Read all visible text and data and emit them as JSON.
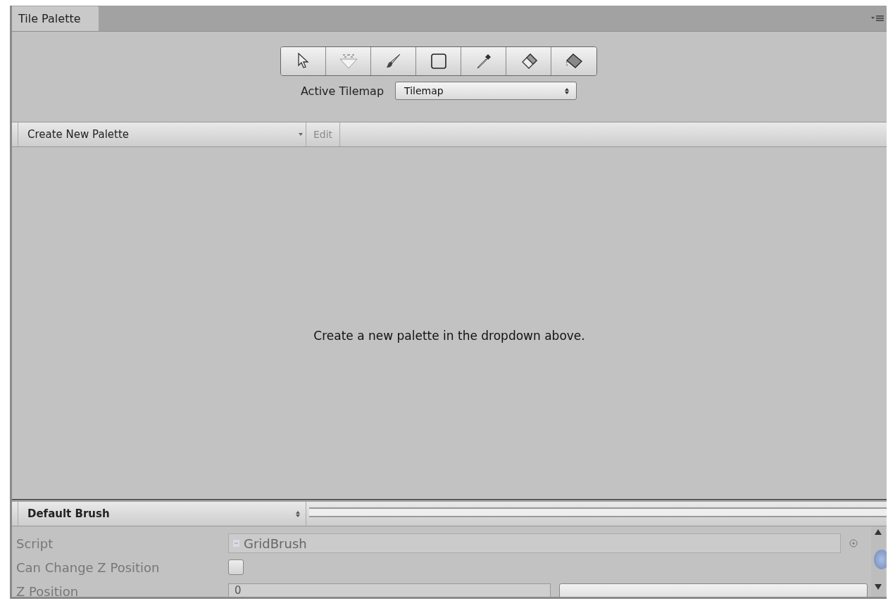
{
  "window": {
    "tab": "Tile Palette"
  },
  "tools": [
    {
      "kind": "select",
      "selected": false
    },
    {
      "kind": "move",
      "selected": false
    },
    {
      "kind": "paint",
      "selected": false
    },
    {
      "kind": "box",
      "selected": false
    },
    {
      "kind": "picker",
      "selected": false
    },
    {
      "kind": "erase",
      "selected": false
    },
    {
      "kind": "fill",
      "selected": false
    }
  ],
  "active_tilemap": {
    "label": "Active Tilemap",
    "value": "Tilemap"
  },
  "palette_bar": {
    "dropdown": "Create New Palette",
    "edit": "Edit",
    "edit_disabled": true
  },
  "empty_message": "Create a new palette in the dropdown above.",
  "brush_bar": {
    "dropdown": "Default Brush"
  },
  "inspector": [
    {
      "kind": "object",
      "label": "Script",
      "value": "GridBrush"
    },
    {
      "kind": "checkbox",
      "label": "Can Change Z Position",
      "checked": false
    },
    {
      "kind": "number",
      "label": "Z Position",
      "value": "0"
    }
  ]
}
